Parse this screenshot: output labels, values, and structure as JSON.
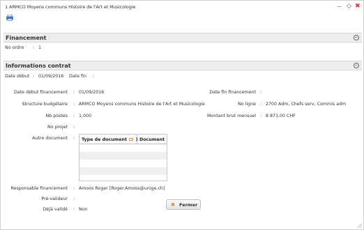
{
  "window": {
    "title": "1 ARMCO Moyens communs Histoire de l'Art et Musicologie",
    "min_glyph": "—",
    "max_glyph": "◇",
    "close_glyph": "✖"
  },
  "financement": {
    "heading": "Financement",
    "toggle": "−",
    "no_ordre_label": "No ordre",
    "sep": ":",
    "no_ordre_value": "1"
  },
  "contrat": {
    "heading": "Informations contrat",
    "toggle": "−",
    "date_debut_label": "Date début",
    "date_debut_value": "01/09/2016",
    "date_fin_label": "Date fin",
    "date_fin_value": ""
  },
  "fields": {
    "date_debut_fin_label": "Date début financement",
    "date_debut_fin_value": "01/09/2016",
    "date_fin_fin_label": "Date fin financement",
    "date_fin_fin_value": "",
    "structure_label": "Structure budgétaire",
    "structure_value": "ARMCO Moyens communs Histoire de l'Art et Musicologie",
    "no_ligne_label": "No ligne",
    "no_ligne_value": "2700 Adm, Chefs serv, Commis adm",
    "nb_postes_label": "Nb postes",
    "nb_postes_value": "1,000",
    "montant_label": "Montant brut mensuel",
    "montant_value": "8 873,00 CHF",
    "no_projet_label": "No projet",
    "no_projet_value": "",
    "autre_doc_label": "Autre document",
    "responsable_label": "Responsable financement",
    "responsable_value": "Amoos Roger [Roger.Amoos@unige.ch]",
    "prevalideur_label": "Pré-valideur",
    "prevalideur_value": "",
    "deja_valide_label": "Déjà validé",
    "deja_valide_value": "Non"
  },
  "doc_table": {
    "col1": "Type de document",
    "col1_sort_num": "1",
    "col2": "Document"
  },
  "footer": {
    "close_label": "Fermer",
    "close_glyph": "✖"
  },
  "colors": {
    "close_accent": "#e07b1a",
    "header_bg": "#ededed"
  }
}
